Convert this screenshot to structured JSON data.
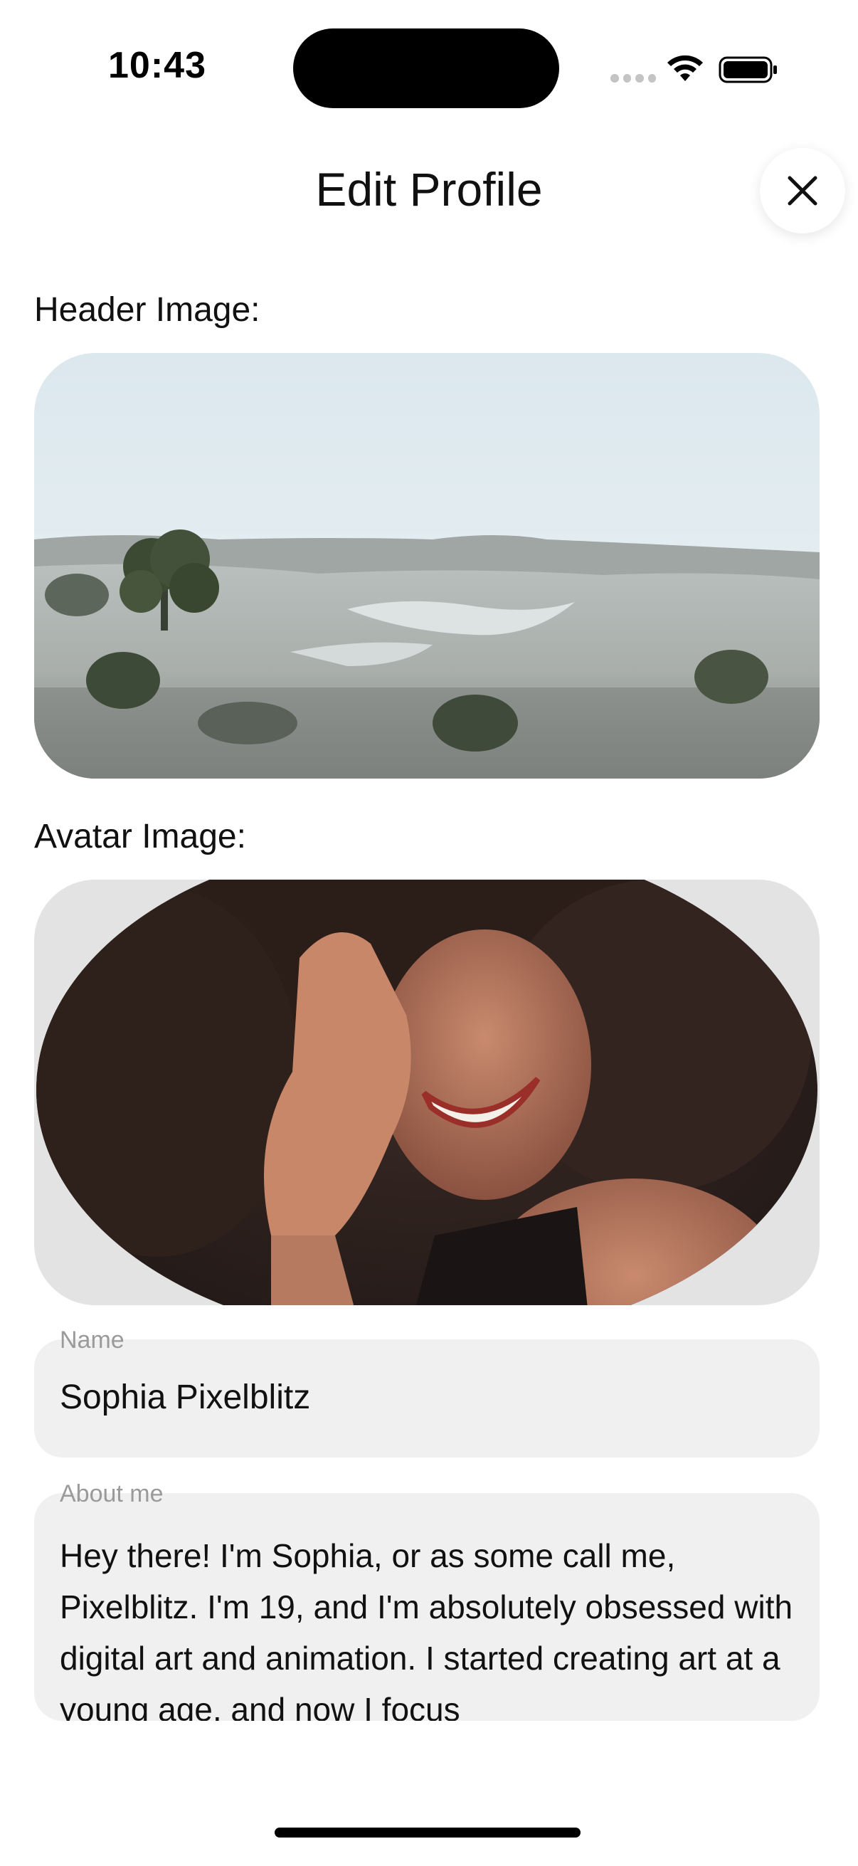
{
  "status_bar": {
    "time": "10:43"
  },
  "header": {
    "title": "Edit Profile",
    "close_icon": "close-icon"
  },
  "sections": {
    "header_image_label": "Header Image:",
    "avatar_image_label": "Avatar Image:"
  },
  "form": {
    "name": {
      "label": "Name",
      "value": "Sophia Pixelblitz"
    },
    "about": {
      "label": "About me",
      "value": "Hey there! I'm Sophia, or as some call me, Pixelblitz. I'm 19, and I'm absolutely obsessed with digital art and animation. I started creating art at a young age, and now I focus"
    }
  },
  "colors": {
    "field_bg": "#f0f0f0",
    "label_gray": "#9a9a9a",
    "avatar_frame": "#e3e3e3"
  }
}
